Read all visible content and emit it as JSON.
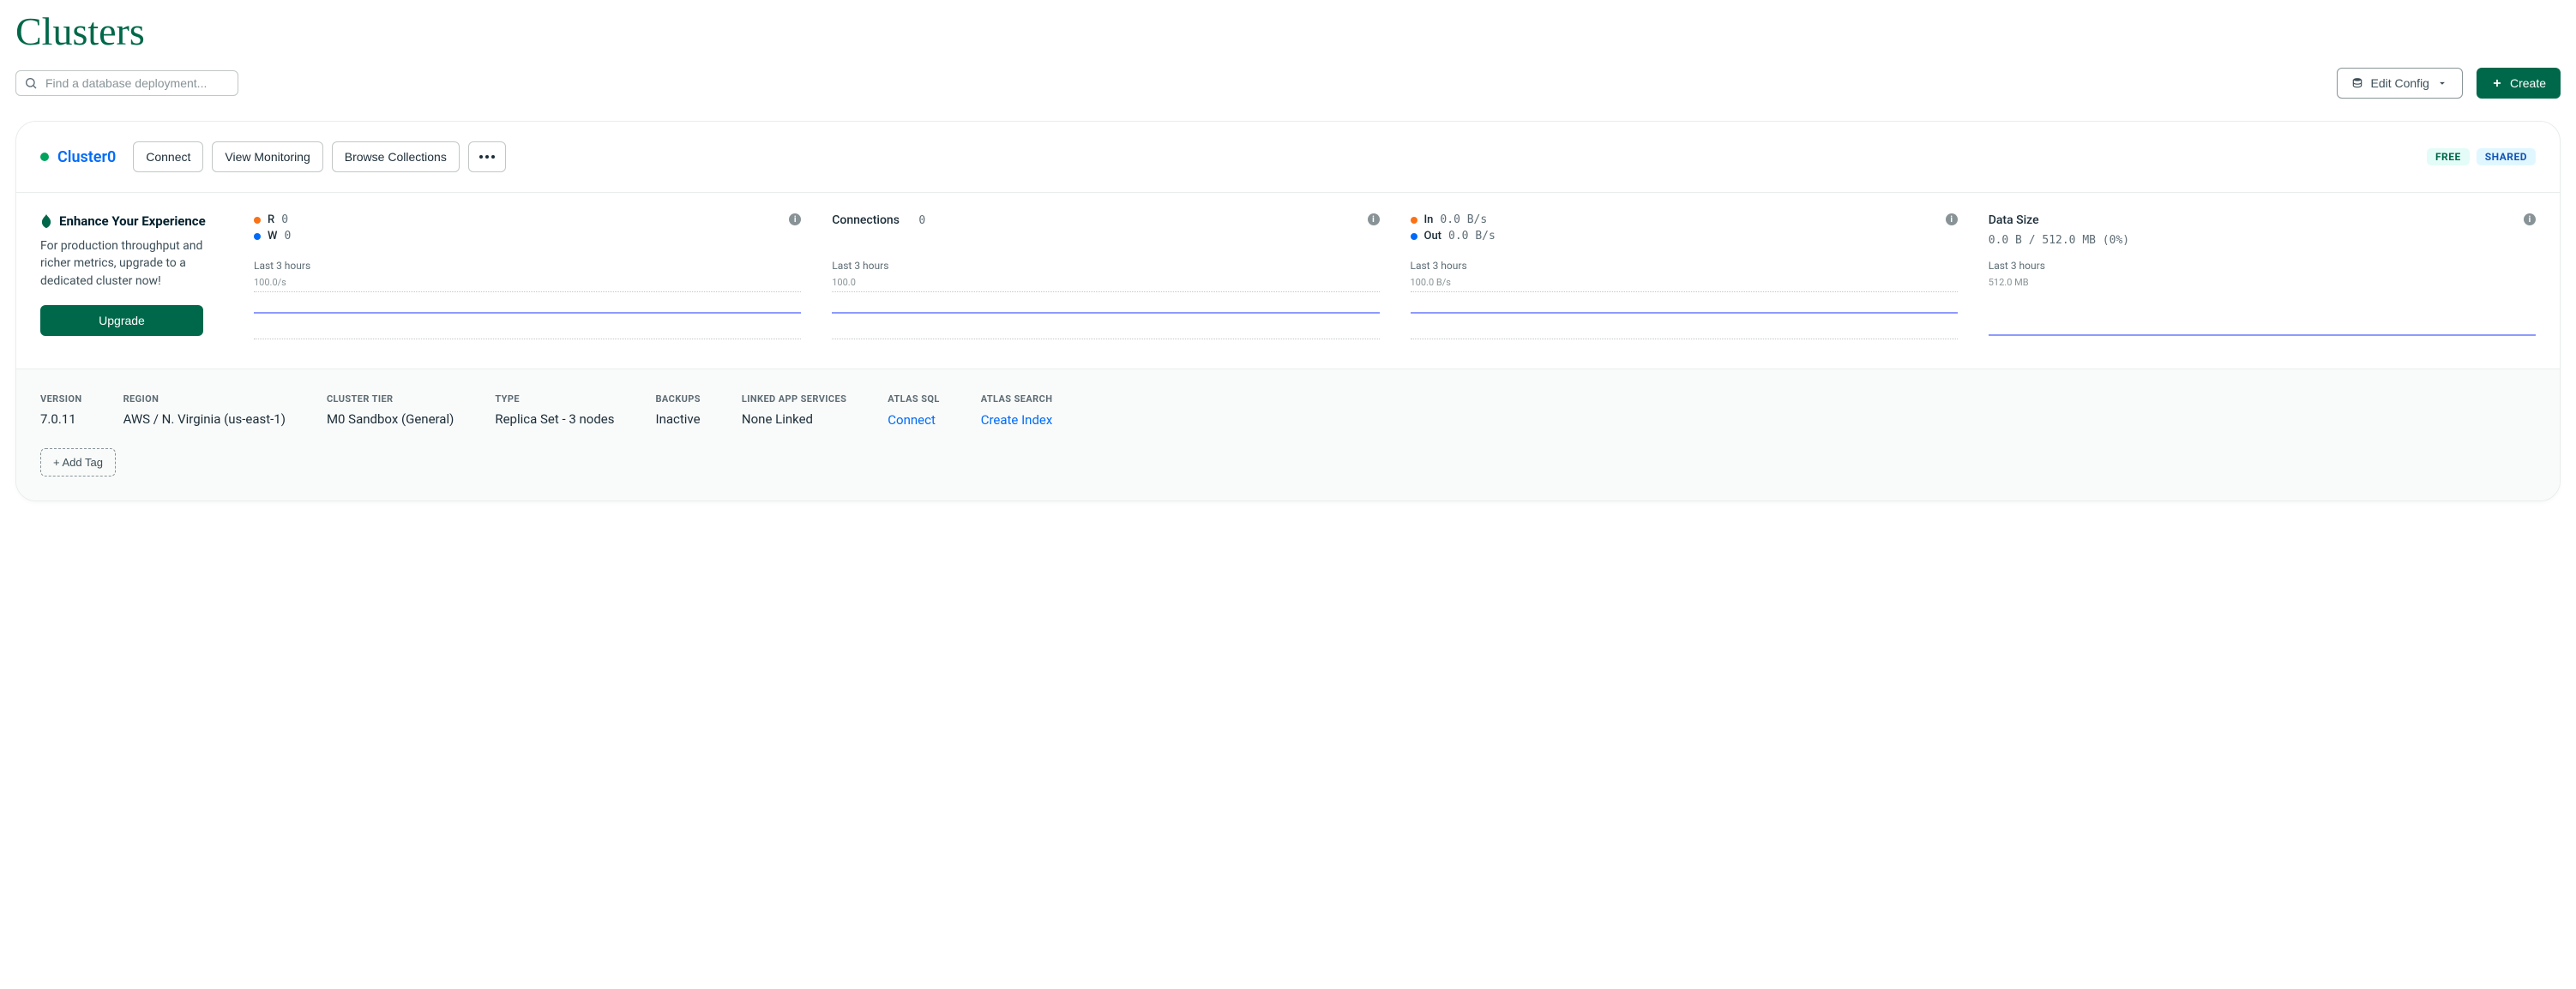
{
  "page_title": "Clusters",
  "search": {
    "placeholder": "Find a database deployment..."
  },
  "top_buttons": {
    "edit_config": "Edit Config",
    "create": "Create"
  },
  "cluster": {
    "name": "Cluster0",
    "status": "active",
    "actions": {
      "connect": "Connect",
      "view_monitoring": "View Monitoring",
      "browse_collections": "Browse Collections"
    },
    "badges": {
      "free": "FREE",
      "shared": "SHARED"
    }
  },
  "enhance": {
    "title": "Enhance Your Experience",
    "description": "For production throughput and richer metrics, upgrade to a dedicated cluster now!",
    "upgrade_button": "Upgrade"
  },
  "metrics": {
    "rw": {
      "r_label": "R",
      "r_value": "0",
      "w_label": "W",
      "w_value": "0",
      "timeframe": "Last 3 hours",
      "scale": "100.0/s"
    },
    "connections": {
      "title": "Connections",
      "value": "0",
      "timeframe": "Last 3 hours",
      "scale": "100.0"
    },
    "network": {
      "in_label": "In",
      "in_value": "0.0 B/s",
      "out_label": "Out",
      "out_value": "0.0 B/s",
      "timeframe": "Last 3 hours",
      "scale": "100.0 B/s"
    },
    "data_size": {
      "title": "Data Size",
      "value": "0.0 B / 512.0 MB (0%)",
      "timeframe": "Last 3 hours",
      "scale": "512.0 MB"
    }
  },
  "footer": {
    "version": {
      "label": "VERSION",
      "value": "7.0.11"
    },
    "region": {
      "label": "REGION",
      "value": "AWS / N. Virginia (us-east-1)"
    },
    "cluster_tier": {
      "label": "CLUSTER TIER",
      "value": "M0 Sandbox (General)"
    },
    "type": {
      "label": "TYPE",
      "value": "Replica Set - 3 nodes"
    },
    "backups": {
      "label": "BACKUPS",
      "value": "Inactive"
    },
    "linked_app": {
      "label": "LINKED APP SERVICES",
      "value": "None Linked"
    },
    "atlas_sql": {
      "label": "ATLAS SQL",
      "link": "Connect"
    },
    "atlas_search": {
      "label": "ATLAS SEARCH",
      "link": "Create Index"
    },
    "add_tag": "+ Add Tag"
  },
  "chart_data": [
    {
      "type": "line",
      "title": "R/W operations",
      "series": [
        {
          "name": "R",
          "color": "#F97216",
          "values": [
            0,
            0,
            0,
            0,
            0,
            0,
            0,
            0,
            0,
            0,
            0,
            0
          ]
        },
        {
          "name": "W",
          "color": "#016BF8",
          "values": [
            0,
            0,
            0,
            0,
            0,
            0,
            0,
            0,
            0,
            0,
            0,
            0
          ]
        }
      ],
      "x_span_hours": 3,
      "ylim": [
        0,
        100
      ],
      "y_unit": "/s"
    },
    {
      "type": "line",
      "title": "Connections",
      "series": [
        {
          "name": "Connections",
          "color": "#8F9AFD",
          "values": [
            0,
            0,
            0,
            0,
            0,
            0,
            0,
            0,
            0,
            0,
            0,
            0
          ]
        }
      ],
      "x_span_hours": 3,
      "ylim": [
        0,
        100
      ],
      "y_unit": ""
    },
    {
      "type": "line",
      "title": "Network In/Out",
      "series": [
        {
          "name": "In",
          "color": "#F97216",
          "values": [
            0,
            0,
            0,
            0,
            0,
            0,
            0,
            0,
            0,
            0,
            0,
            0
          ]
        },
        {
          "name": "Out",
          "color": "#016BF8",
          "values": [
            0,
            0,
            0,
            0,
            0,
            0,
            0,
            0,
            0,
            0,
            0,
            0
          ]
        }
      ],
      "x_span_hours": 3,
      "ylim": [
        0,
        100
      ],
      "y_unit": "B/s"
    },
    {
      "type": "line",
      "title": "Data Size",
      "series": [
        {
          "name": "Data Size",
          "color": "#8F9AFD",
          "values": [
            0,
            0,
            0,
            0,
            0,
            0,
            0,
            0,
            0,
            0,
            0,
            0
          ]
        }
      ],
      "x_span_hours": 3,
      "ylim": [
        0,
        512
      ],
      "y_unit": "MB"
    }
  ]
}
